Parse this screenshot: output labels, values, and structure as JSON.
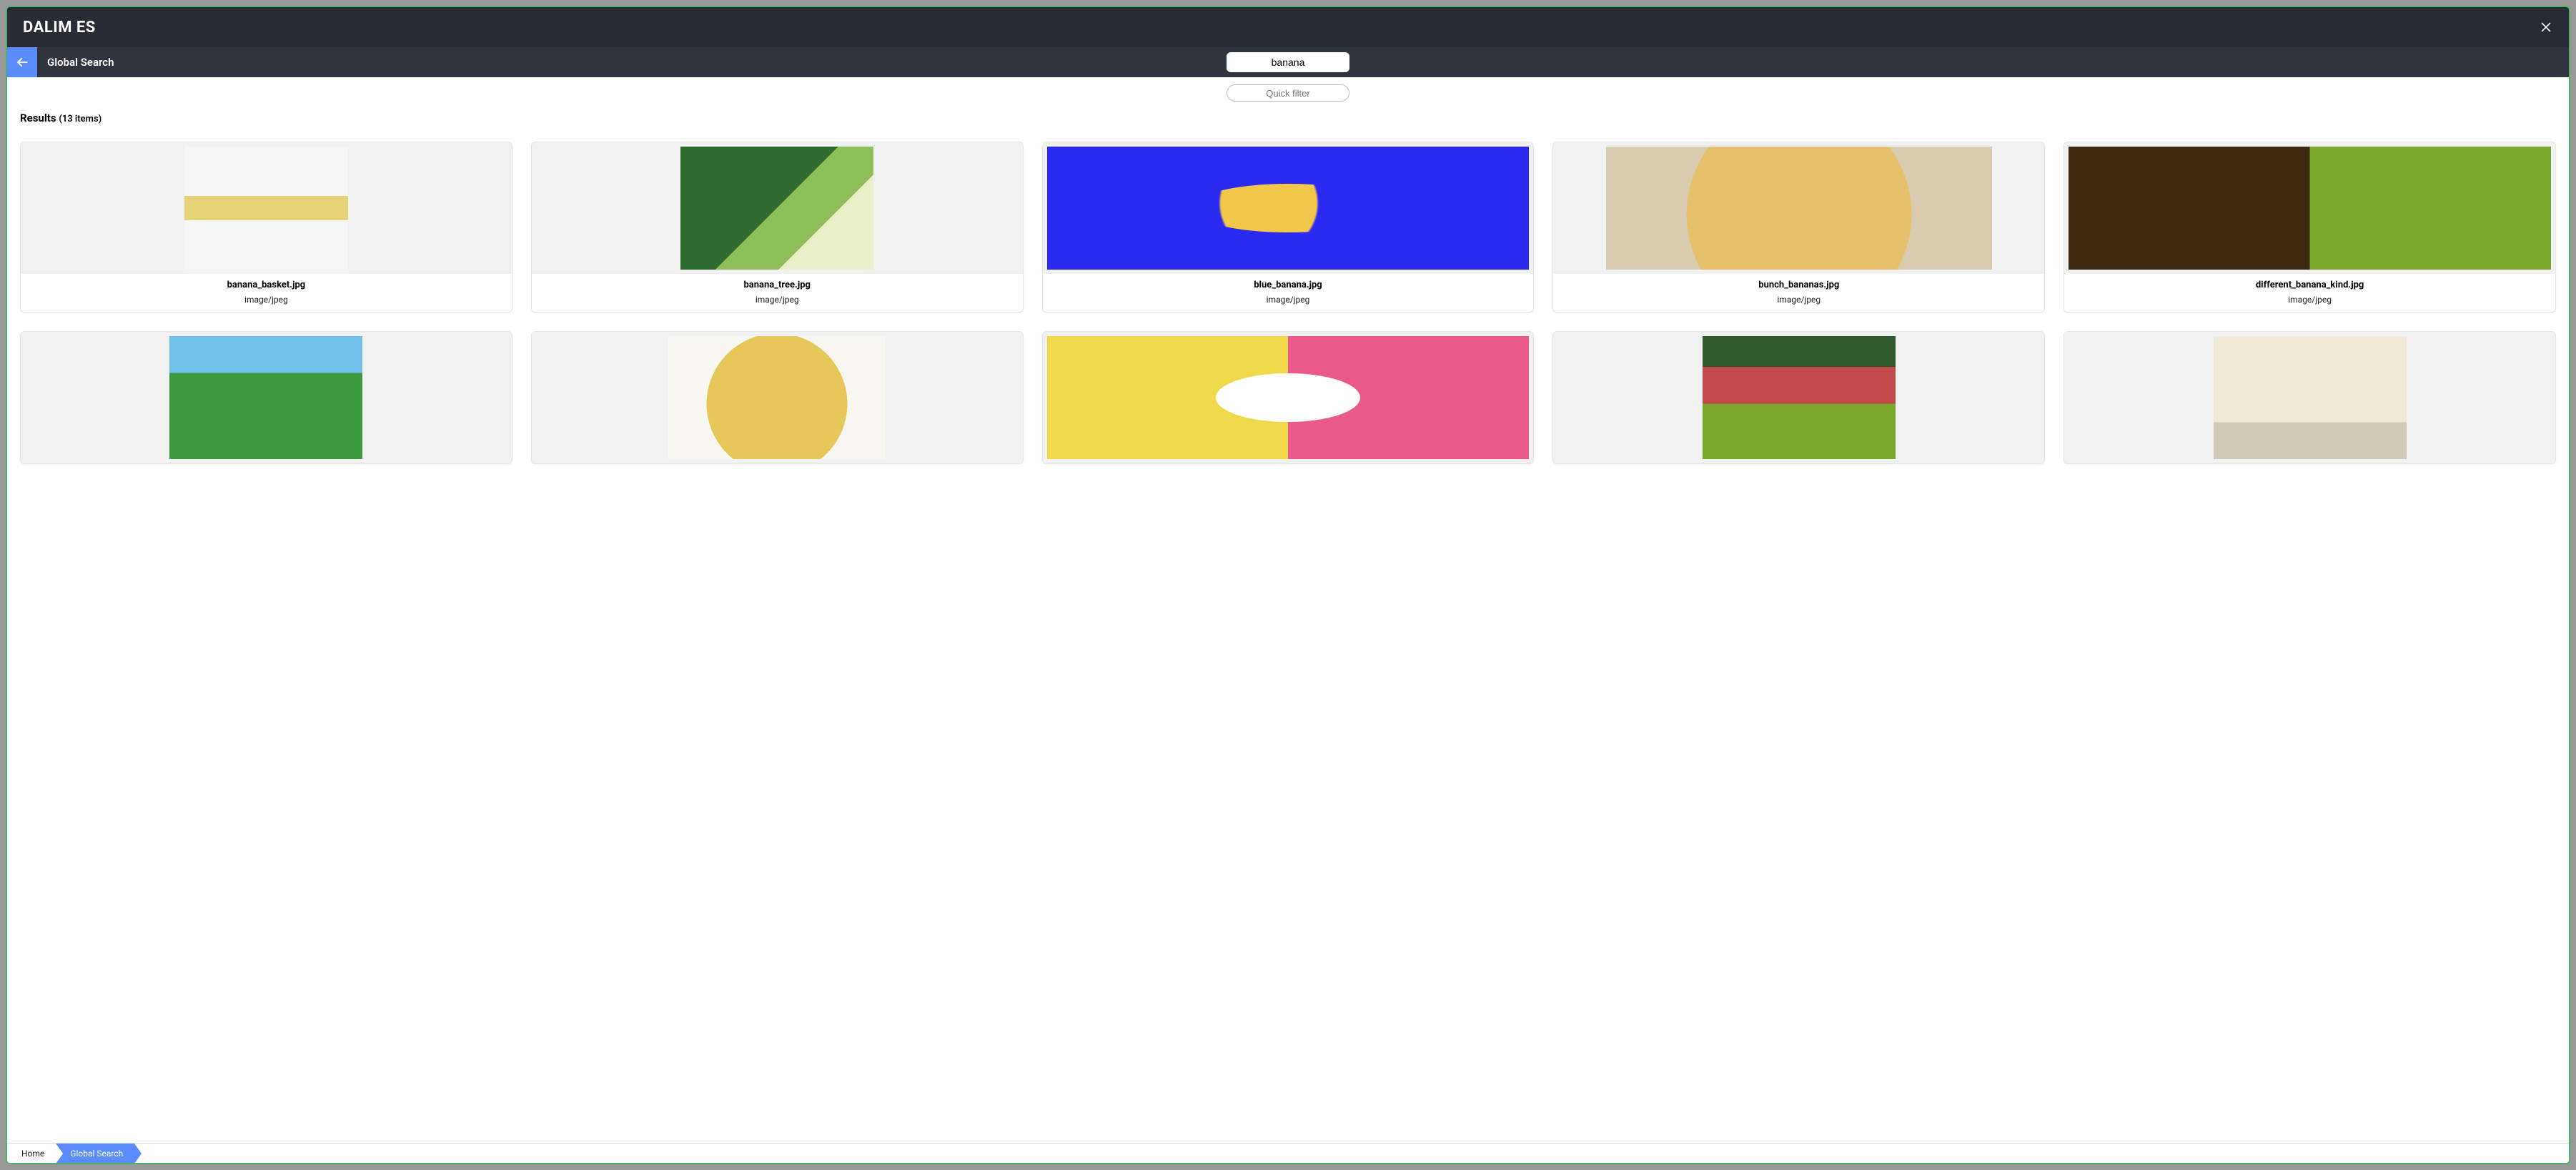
{
  "window": {
    "title": "DALIM ES"
  },
  "subbar": {
    "label": "Global Search"
  },
  "search": {
    "value": "banana"
  },
  "filter": {
    "placeholder": "Quick filter"
  },
  "results": {
    "label": "Results",
    "count_text": "(13 items)",
    "items": [
      {
        "filename": "banana_basket.jpg",
        "mime": "image/jpeg",
        "art": "art-banana-basket",
        "wide": false
      },
      {
        "filename": "banana_tree.jpg",
        "mime": "image/jpeg",
        "art": "art-banana-tree",
        "wide": false
      },
      {
        "filename": "blue_banana.jpg",
        "mime": "image/jpeg",
        "art": "art-blue-banana",
        "wide": true
      },
      {
        "filename": "bunch_bananas.jpg",
        "mime": "image/jpeg",
        "art": "art-bunch",
        "wide": false
      },
      {
        "filename": "different_banana_kind.jpg",
        "mime": "image/jpeg",
        "art": "art-diff-kind",
        "wide": true
      },
      {
        "filename": "",
        "mime": "",
        "art": "art-green-tree",
        "wide": false,
        "cut": true
      },
      {
        "filename": "",
        "mime": "",
        "art": "art-peeled",
        "wide": false,
        "cut": true
      },
      {
        "filename": "",
        "mime": "",
        "art": "art-soup",
        "wide": true,
        "cut": true
      },
      {
        "filename": "",
        "mime": "",
        "art": "art-red",
        "wide": false,
        "cut": true
      },
      {
        "filename": "",
        "mime": "",
        "art": "art-window",
        "wide": false,
        "cut": true
      }
    ]
  },
  "breadcrumb": {
    "home": "Home",
    "current": "Global Search"
  }
}
